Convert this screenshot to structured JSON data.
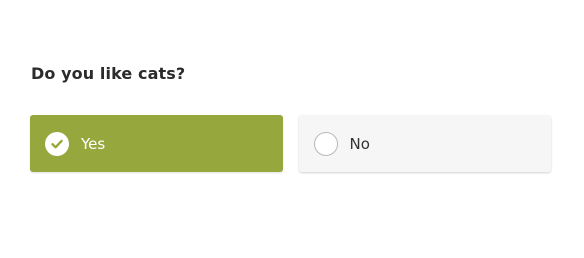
{
  "question": {
    "text": "Do you like cats?"
  },
  "options": [
    {
      "label": "Yes",
      "selected": true,
      "icon": "check-circle-icon"
    },
    {
      "label": "No",
      "selected": false,
      "icon": "radio-empty-icon"
    }
  ],
  "colors": {
    "selected_bg": "#96a83d",
    "unselected_bg": "#f6f6f6",
    "text_dark": "#2b2b2b"
  }
}
